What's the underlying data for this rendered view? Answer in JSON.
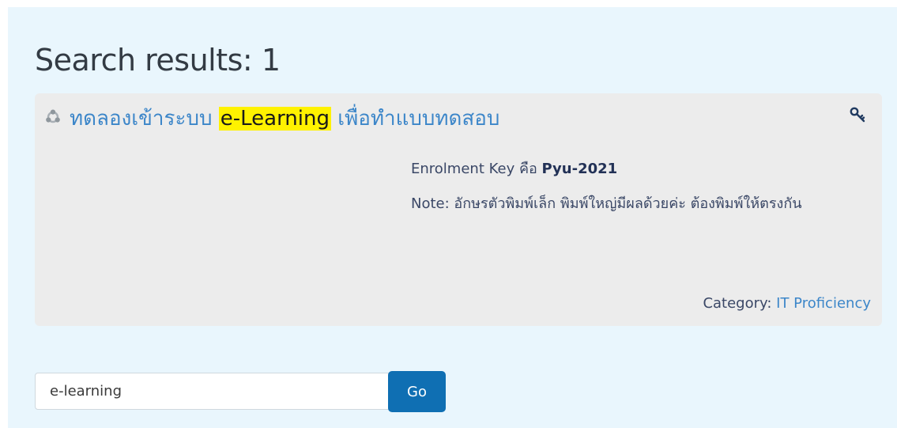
{
  "results": {
    "heading": "Search results: 1"
  },
  "course": {
    "title_before": "ทดลองเข้าระบบ ",
    "title_highlight": "e-Learning",
    "title_after": " เพื่อทำแบบทดสอบ",
    "icon": "course-icon",
    "enrol_icon": "key-icon",
    "enrol_label": "Enrolment Key คือ ",
    "enrol_key": "Pyu-2021",
    "note": "Note: อักษรตัวพิมพ์เล็ก พิมพ์ใหญ่มีผลด้วยค่ะ ต้องพิมพ์ให้ตรงกัน",
    "category_label": "Category: ",
    "category_value": "IT Proficiency"
  },
  "search": {
    "value": "e-learning",
    "button_label": "Go"
  },
  "colors": {
    "link": "#3c86c9",
    "highlight": "#fff200",
    "button": "#0f6fb3",
    "panel": "#e9f6fd",
    "card": "#ececec"
  }
}
